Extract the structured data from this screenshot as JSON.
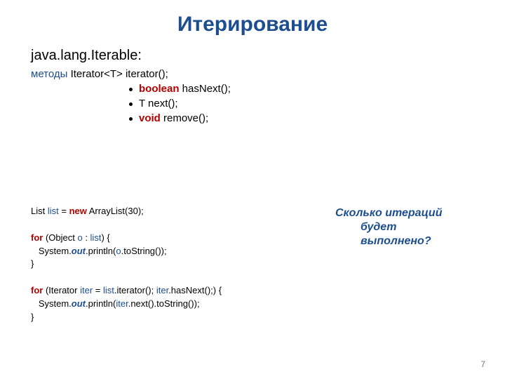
{
  "title": "Итерирование",
  "iface": "java.lang.Iterable:",
  "methods_prefix": "методы",
  "methods_sig": " Iterator<T> iterator();",
  "bullets": [
    {
      "kw": "boolean",
      "rest": " hasNext();"
    },
    {
      "kw": "",
      "rest": "T next();"
    },
    {
      "kw": "void",
      "rest": " remove();"
    }
  ],
  "code": {
    "l1a": "List ",
    "l1b": "list",
    "l1c": " = ",
    "l1d": "new",
    "l1e": " ArrayList(30);",
    "l2": "",
    "l3a": "for",
    "l3b": " (Object ",
    "l3c": "o",
    "l3d": " : ",
    "l3e": "list",
    "l3f": ") {",
    "l4a": "   System.",
    "l4b": "out",
    "l4c": ".println(",
    "l4d": "o",
    "l4e": ".toString());",
    "l5": "}",
    "l6": "",
    "l7a": "for",
    "l7b": " (Iterator ",
    "l7c": "iter",
    "l7d": " = ",
    "l7e": "list",
    "l7f": ".iterator(); ",
    "l7g": "iter",
    "l7h": ".hasNext();) {",
    "l8a": "   System.",
    "l8b": "out",
    "l8c": ".println(",
    "l8d": "iter",
    "l8e": ".next().toString());",
    "l9": "}"
  },
  "question": {
    "l1": "Сколько итераций",
    "l2": "будет",
    "l3": "выполнено?"
  },
  "page": "7"
}
